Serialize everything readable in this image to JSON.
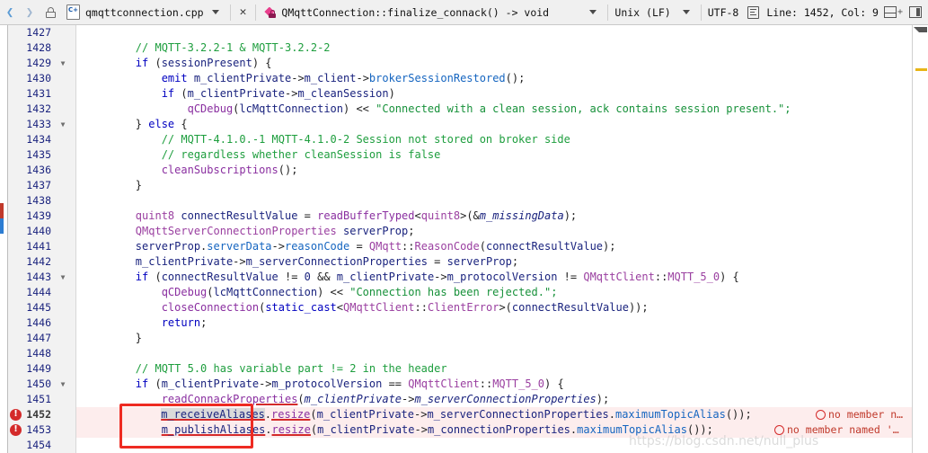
{
  "toolbar": {
    "back_icon": "chevron-left-icon",
    "forward_icon": "chevron-right-icon",
    "lock_icon": "unlock-icon",
    "file_icon": "cpp-file-icon",
    "filename": "qmqttconnection.cpp",
    "file_dropdown_icon": "chevron-down-icon",
    "close_label": "✕",
    "symbol_icon": "private-method-icon",
    "symbol": "QMqttConnection::finalize_connack() -> void",
    "symbol_dropdown_icon": "chevron-down-icon",
    "line_ending": "Unix (LF)",
    "line_ending_dropdown_icon": "chevron-down-icon",
    "encoding": "UTF-8",
    "encoding_icon": "text-encoding-icon",
    "cursor_position": "Line: 1452, Col: 9",
    "split_icon": "split-horizontal-add-icon",
    "panel_icon": "toggle-side-panel-icon"
  },
  "editor": {
    "first_line": 1427,
    "current_line": 1452,
    "error_lines": [
      1452,
      1453
    ],
    "fold_lines": [
      1429,
      1433,
      1443,
      1450
    ],
    "lines": [
      {
        "n": 1427,
        "tokens": []
      },
      {
        "n": 1428,
        "tokens": [
          {
            "t": "        ",
            "c": "pl"
          },
          {
            "t": "// MQTT-3.2.2-1 & MQTT-3.2.2-2",
            "c": "cm"
          }
        ]
      },
      {
        "n": 1429,
        "tokens": [
          {
            "t": "        ",
            "c": "pl"
          },
          {
            "t": "if",
            "c": "kw"
          },
          {
            "t": " (",
            "c": "op"
          },
          {
            "t": "sessionPresent",
            "c": "var"
          },
          {
            "t": ") {",
            "c": "op"
          }
        ]
      },
      {
        "n": 1430,
        "tokens": [
          {
            "t": "            ",
            "c": "pl"
          },
          {
            "t": "emit",
            "c": "kw"
          },
          {
            "t": " ",
            "c": "pl"
          },
          {
            "t": "m_clientPrivate",
            "c": "var"
          },
          {
            "t": "->",
            "c": "op"
          },
          {
            "t": "m_client",
            "c": "var"
          },
          {
            "t": "->",
            "c": "op"
          },
          {
            "t": "brokerSessionRestored",
            "c": "blue"
          },
          {
            "t": "();",
            "c": "op"
          }
        ]
      },
      {
        "n": 1431,
        "tokens": [
          {
            "t": "            ",
            "c": "pl"
          },
          {
            "t": "if",
            "c": "kw"
          },
          {
            "t": " (",
            "c": "op"
          },
          {
            "t": "m_clientPrivate",
            "c": "var"
          },
          {
            "t": "->",
            "c": "op"
          },
          {
            "t": "m_cleanSession",
            "c": "var"
          },
          {
            "t": ")",
            "c": "op"
          }
        ]
      },
      {
        "n": 1432,
        "tokens": [
          {
            "t": "                ",
            "c": "pl"
          },
          {
            "t": "qCDebug",
            "c": "fn"
          },
          {
            "t": "(",
            "c": "op"
          },
          {
            "t": "lcMqttConnection",
            "c": "var"
          },
          {
            "t": ") << ",
            "c": "op"
          },
          {
            "t": "\"Connected with a clean session, ack contains session present.\";",
            "c": "st"
          }
        ]
      },
      {
        "n": 1433,
        "tokens": [
          {
            "t": "        ",
            "c": "pl"
          },
          {
            "t": "} ",
            "c": "op"
          },
          {
            "t": "else",
            "c": "kw"
          },
          {
            "t": " {",
            "c": "op"
          }
        ]
      },
      {
        "n": 1434,
        "tokens": [
          {
            "t": "            ",
            "c": "pl"
          },
          {
            "t": "// MQTT-4.1.0.-1 MQTT-4.1.0-2 Session not stored on broker side",
            "c": "cm"
          }
        ]
      },
      {
        "n": 1435,
        "tokens": [
          {
            "t": "            ",
            "c": "pl"
          },
          {
            "t": "// regardless whether cleanSession is false",
            "c": "cm"
          }
        ]
      },
      {
        "n": 1436,
        "tokens": [
          {
            "t": "            ",
            "c": "pl"
          },
          {
            "t": "cleanSubscriptions",
            "c": "fn"
          },
          {
            "t": "();",
            "c": "op"
          }
        ]
      },
      {
        "n": 1437,
        "tokens": [
          {
            "t": "        }",
            "c": "op"
          }
        ]
      },
      {
        "n": 1438,
        "tokens": []
      },
      {
        "n": 1439,
        "tokens": [
          {
            "t": "        ",
            "c": "pl"
          },
          {
            "t": "quint8",
            "c": "ty"
          },
          {
            "t": " ",
            "c": "pl"
          },
          {
            "t": "connectResultValue",
            "c": "var"
          },
          {
            "t": " = ",
            "c": "op"
          },
          {
            "t": "readBufferTyped",
            "c": "fn"
          },
          {
            "t": "<",
            "c": "op"
          },
          {
            "t": "quint8",
            "c": "ty"
          },
          {
            "t": ">(&",
            "c": "op"
          },
          {
            "t": "m_missingData",
            "c": "mem"
          },
          {
            "t": ");",
            "c": "op"
          }
        ]
      },
      {
        "n": 1440,
        "tokens": [
          {
            "t": "        ",
            "c": "pl"
          },
          {
            "t": "QMqttServerConnectionProperties",
            "c": "ty"
          },
          {
            "t": " ",
            "c": "pl"
          },
          {
            "t": "serverProp",
            "c": "var"
          },
          {
            "t": ";",
            "c": "op"
          }
        ]
      },
      {
        "n": 1441,
        "tokens": [
          {
            "t": "        ",
            "c": "pl"
          },
          {
            "t": "serverProp",
            "c": "var"
          },
          {
            "t": ".",
            "c": "op"
          },
          {
            "t": "serverData",
            "c": "blue"
          },
          {
            "t": "->",
            "c": "op"
          },
          {
            "t": "reasonCode",
            "c": "blue"
          },
          {
            "t": " = ",
            "c": "op"
          },
          {
            "t": "QMqtt",
            "c": "ty"
          },
          {
            "t": "::",
            "c": "op"
          },
          {
            "t": "ReasonCode",
            "c": "ty"
          },
          {
            "t": "(",
            "c": "op"
          },
          {
            "t": "connectResultValue",
            "c": "var"
          },
          {
            "t": ");",
            "c": "op"
          }
        ]
      },
      {
        "n": 1442,
        "tokens": [
          {
            "t": "        ",
            "c": "pl"
          },
          {
            "t": "m_clientPrivate",
            "c": "var"
          },
          {
            "t": "->",
            "c": "op"
          },
          {
            "t": "m_serverConnectionProperties",
            "c": "var"
          },
          {
            "t": " = ",
            "c": "op"
          },
          {
            "t": "serverProp",
            "c": "var"
          },
          {
            "t": ";",
            "c": "op"
          }
        ]
      },
      {
        "n": 1443,
        "tokens": [
          {
            "t": "        ",
            "c": "pl"
          },
          {
            "t": "if",
            "c": "kw"
          },
          {
            "t": " (",
            "c": "op"
          },
          {
            "t": "connectResultValue",
            "c": "var"
          },
          {
            "t": " != ",
            "c": "op"
          },
          {
            "t": "0",
            "c": "num"
          },
          {
            "t": " && ",
            "c": "op"
          },
          {
            "t": "m_clientPrivate",
            "c": "var"
          },
          {
            "t": "->",
            "c": "op"
          },
          {
            "t": "m_protocolVersion",
            "c": "var"
          },
          {
            "t": " != ",
            "c": "op"
          },
          {
            "t": "QMqttClient",
            "c": "ty"
          },
          {
            "t": "::",
            "c": "op"
          },
          {
            "t": "MQTT_5_0",
            "c": "ty"
          },
          {
            "t": ") {",
            "c": "op"
          }
        ]
      },
      {
        "n": 1444,
        "tokens": [
          {
            "t": "            ",
            "c": "pl"
          },
          {
            "t": "qCDebug",
            "c": "fn"
          },
          {
            "t": "(",
            "c": "op"
          },
          {
            "t": "lcMqttConnection",
            "c": "var"
          },
          {
            "t": ") << ",
            "c": "op"
          },
          {
            "t": "\"Connection has been rejected.\";",
            "c": "st"
          }
        ]
      },
      {
        "n": 1445,
        "tokens": [
          {
            "t": "            ",
            "c": "pl"
          },
          {
            "t": "closeConnection",
            "c": "fn"
          },
          {
            "t": "(",
            "c": "op"
          },
          {
            "t": "static_cast",
            "c": "kw"
          },
          {
            "t": "<",
            "c": "op"
          },
          {
            "t": "QMqttClient",
            "c": "ty"
          },
          {
            "t": "::",
            "c": "op"
          },
          {
            "t": "ClientError",
            "c": "ty"
          },
          {
            "t": ">(",
            "c": "op"
          },
          {
            "t": "connectResultValue",
            "c": "var"
          },
          {
            "t": "));",
            "c": "op"
          }
        ]
      },
      {
        "n": 1446,
        "tokens": [
          {
            "t": "            ",
            "c": "pl"
          },
          {
            "t": "return",
            "c": "kw"
          },
          {
            "t": ";",
            "c": "op"
          }
        ]
      },
      {
        "n": 1447,
        "tokens": [
          {
            "t": "        }",
            "c": "op"
          }
        ]
      },
      {
        "n": 1448,
        "tokens": []
      },
      {
        "n": 1449,
        "tokens": [
          {
            "t": "        ",
            "c": "pl"
          },
          {
            "t": "// MQTT 5.0 has variable part != 2 in the header",
            "c": "cm"
          }
        ]
      },
      {
        "n": 1450,
        "tokens": [
          {
            "t": "        ",
            "c": "pl"
          },
          {
            "t": "if",
            "c": "kw"
          },
          {
            "t": " (",
            "c": "op"
          },
          {
            "t": "m_clientPrivate",
            "c": "var"
          },
          {
            "t": "->",
            "c": "op"
          },
          {
            "t": "m_protocolVersion",
            "c": "var"
          },
          {
            "t": " == ",
            "c": "op"
          },
          {
            "t": "QMqttClient",
            "c": "ty"
          },
          {
            "t": "::",
            "c": "op"
          },
          {
            "t": "MQTT_5_0",
            "c": "ty"
          },
          {
            "t": ") {",
            "c": "op"
          }
        ]
      },
      {
        "n": 1451,
        "tokens": [
          {
            "t": "            ",
            "c": "pl"
          },
          {
            "t": "readConnackProperties",
            "c": "fn errtok2"
          },
          {
            "t": "(",
            "c": "op"
          },
          {
            "t": "m_clientPrivate",
            "c": "mem"
          },
          {
            "t": "->",
            "c": "op"
          },
          {
            "t": "m_serverConnectionProperties",
            "c": "mem"
          },
          {
            "t": ");",
            "c": "op"
          }
        ]
      },
      {
        "n": 1452,
        "tokens": [
          {
            "t": "            ",
            "c": "pl"
          },
          {
            "t": "m_receiveAliases",
            "c": "var errtok2 sel"
          },
          {
            "t": ".",
            "c": "op"
          },
          {
            "t": "resize",
            "c": "fn errtok2"
          },
          {
            "t": "(",
            "c": "op"
          },
          {
            "t": "m_clientPrivate",
            "c": "var"
          },
          {
            "t": "->",
            "c": "op"
          },
          {
            "t": "m_serverConnectionProperties",
            "c": "var"
          },
          {
            "t": ".",
            "c": "op"
          },
          {
            "t": "maximumTopicAlias",
            "c": "blue"
          },
          {
            "t": "());",
            "c": "op"
          }
        ]
      },
      {
        "n": 1453,
        "tokens": [
          {
            "t": "            ",
            "c": "pl"
          },
          {
            "t": "m_publishAliases",
            "c": "var errtok2"
          },
          {
            "t": ".",
            "c": "op"
          },
          {
            "t": "resize",
            "c": "fn errtok2"
          },
          {
            "t": "(",
            "c": "op"
          },
          {
            "t": "m_clientPrivate",
            "c": "var"
          },
          {
            "t": "->",
            "c": "op"
          },
          {
            "t": "m_connectionProperties",
            "c": "var"
          },
          {
            "t": ".",
            "c": "op"
          },
          {
            "t": "maximumTopicAlias",
            "c": "blue"
          },
          {
            "t": "());",
            "c": "op"
          }
        ]
      },
      {
        "n": 1454,
        "tokens": []
      }
    ],
    "error_notes": [
      {
        "line": 1452,
        "text": "no member n…",
        "icon": "error-circle-icon"
      },
      {
        "line": 1453,
        "text": "no member named '…",
        "icon": "error-circle-icon"
      }
    ]
  },
  "annotation": {
    "kind": "red-rectangle-highlight",
    "covers": [
      "m_receiveAliases",
      "m_publishAliases"
    ]
  },
  "watermark": {
    "text": "https://blog.csdn.net/null_plus"
  },
  "colors": {
    "keyword": "#0000c0",
    "comment": "#1e9e3e",
    "string": "#17913a",
    "type": "#9a3fa0",
    "function": "#8a2fa0",
    "variable": "#1a237e",
    "error": "#d42a2a",
    "error_row_bg": "#fdeded",
    "annotation": "#ee2b22",
    "gutter_bg": "#f2f2f2",
    "toolbar_bg": "#f0f0f0"
  }
}
